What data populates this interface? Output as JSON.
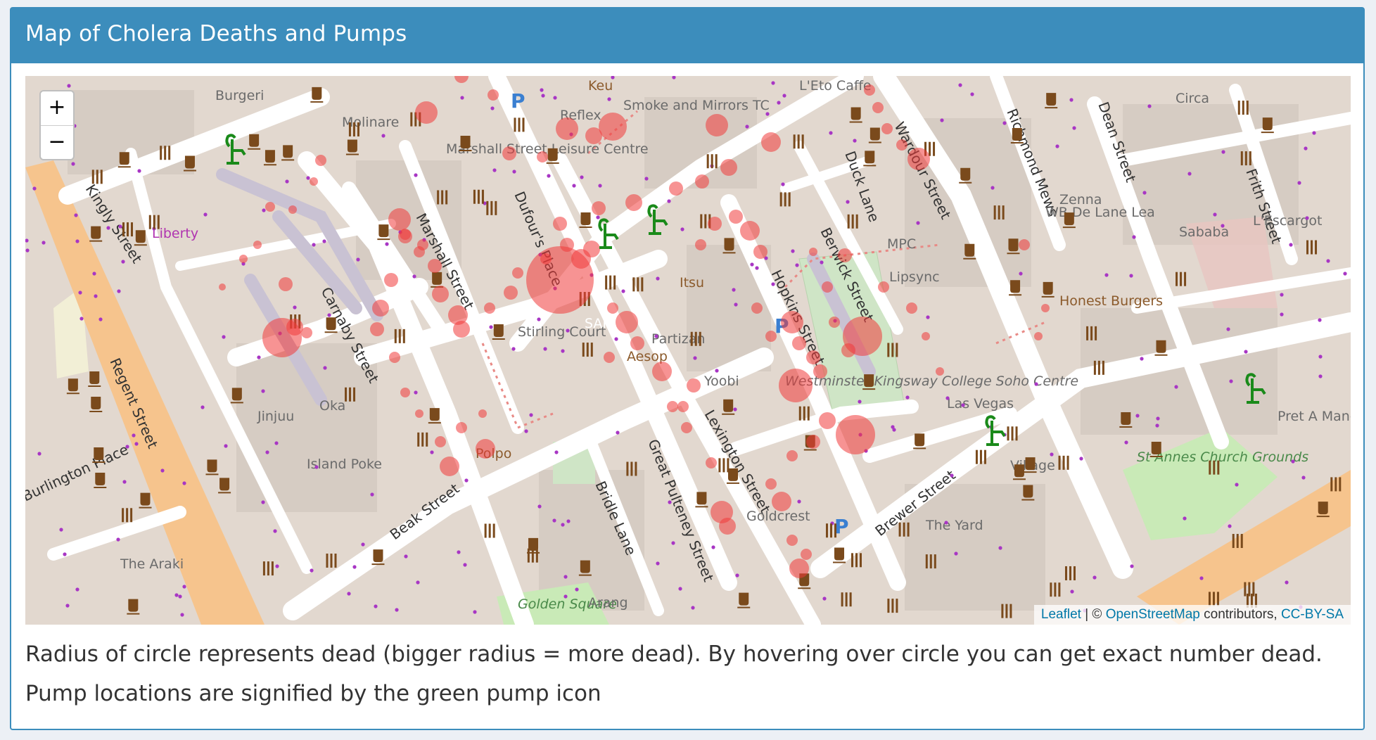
{
  "header": {
    "title": "Map of Cholera Deaths and Pumps"
  },
  "map": {
    "zoom_in_label": "+",
    "zoom_out_label": "−",
    "attribution": {
      "leaflet": "Leaflet",
      "separator": " | © ",
      "osm": "OpenStreetMap",
      "contributors": " contributors, ",
      "license": "CC-BY-SA"
    },
    "street_labels": [
      "Kingly Street",
      "Regent Street",
      "Carnaby Street",
      "Marshall Street",
      "Dufour's Place",
      "Beak Street",
      "Bridle Lane",
      "Great Pulteney Street",
      "Lexington Street",
      "Hopkins Street",
      "Berwick Street",
      "Wardour Street",
      "Richmond Mews",
      "Dean Street",
      "Frith Street",
      "Brewer Street",
      "Duck Lane",
      "Burlington Place"
    ],
    "place_labels": [
      "Molinare",
      "Marshall Street Leisure Centre",
      "Stirling Court",
      "Itsu",
      "Partizan",
      "Aesop",
      "Yoobi",
      "Westminster Kingsway College Soho Centre",
      "Las Vegas",
      "Village",
      "The Yard",
      "St Annes Church Grounds",
      "Goldcrest",
      "Polpo",
      "Island Poke",
      "Jinjuu",
      "Oka",
      "The Araki",
      "Liberty",
      "Smoke and Mirrors TC",
      "Reflex",
      "MPC",
      "Lipsync",
      "Honest Burgers",
      "Zenna",
      "WB De Lane Lea",
      "Sababa",
      "L'Escargot",
      "Circa",
      "Pret A Manger",
      "Golden Square",
      "Arang",
      "Burgeri",
      "L'Eto Caffe",
      "Keu",
      "SAID"
    ],
    "pump_icon": "pump-icon",
    "pump_count": 5,
    "death_circle_color": "#f03b3b",
    "pump_color": "#1a8a1a"
  },
  "description": {
    "line1": "Radius of circle represents dead (bigger radius = more dead). By hovering over circle you can get exact number dead.",
    "line2": "Pump locations are signified by the green pump icon"
  }
}
